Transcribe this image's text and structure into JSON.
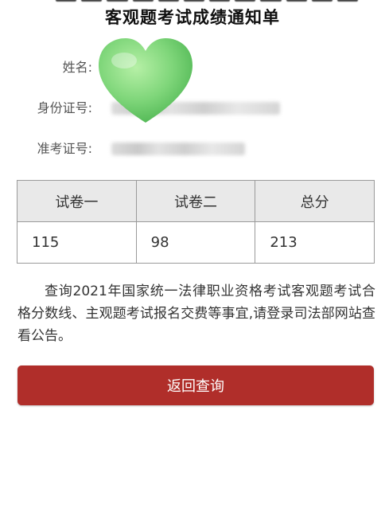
{
  "notice_title": "客观题考试成绩通知单",
  "fields": [
    {
      "label": "姓名:"
    },
    {
      "label": "身份证号:"
    },
    {
      "label": "准考证号:"
    }
  ],
  "sticker": {
    "icon": "green-heart-sticker-icon",
    "color": "#7fd67a"
  },
  "score_table": {
    "headers": [
      "试卷一",
      "试卷二",
      "总分"
    ],
    "values": [
      "115",
      "98",
      "213"
    ]
  },
  "notice_text": "查询2021年国家统一法律职业资格考试客观题考试合格分数线、主观题考试报名交费等事宜,请登录司法部网站查看公告。",
  "back_button_label": "返回查询",
  "colors": {
    "primary_button": "#b02e2a",
    "table_header": "#e9e9e9"
  }
}
